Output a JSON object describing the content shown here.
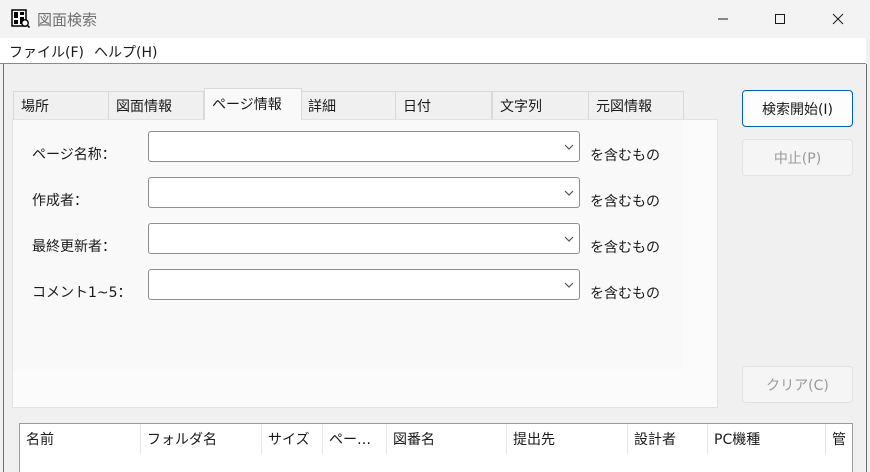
{
  "window": {
    "title": "図面検索",
    "icon": "blueprint-app-icon",
    "controls": [
      "minimize-icon",
      "maximize-icon",
      "close-icon"
    ]
  },
  "menu": [
    "ファイル(F)",
    "ヘルプ(H)"
  ],
  "tabs": {
    "items": [
      "場所",
      "図面情報",
      "ページ情報",
      "詳細",
      "日付",
      "文字列",
      "元図情報"
    ],
    "active": "ページ情報"
  },
  "form": {
    "fields": [
      {
        "label": "ページ名称：",
        "value": "",
        "suffix": "を含むもの"
      },
      {
        "label": "作成者：",
        "value": "",
        "suffix": "を含むもの"
      },
      {
        "label": "最終更新者：",
        "value": "",
        "suffix": "を含むもの"
      },
      {
        "label": "コメント1~5：",
        "value": "",
        "suffix": "を含むもの"
      }
    ]
  },
  "buttons": {
    "search": "検索開始(I)",
    "stop": "中止(P)",
    "clear": "クリア(C)"
  },
  "results": {
    "columns": [
      "名前",
      "フォルダ名",
      "サイズ",
      "ペー…",
      "図番名",
      "提出先",
      "設計者",
      "PC機種",
      "管"
    ]
  },
  "colors": {
    "accent": "#005fb8",
    "background": "#f0f0f0",
    "disabled_text": "#9a9a9a"
  }
}
